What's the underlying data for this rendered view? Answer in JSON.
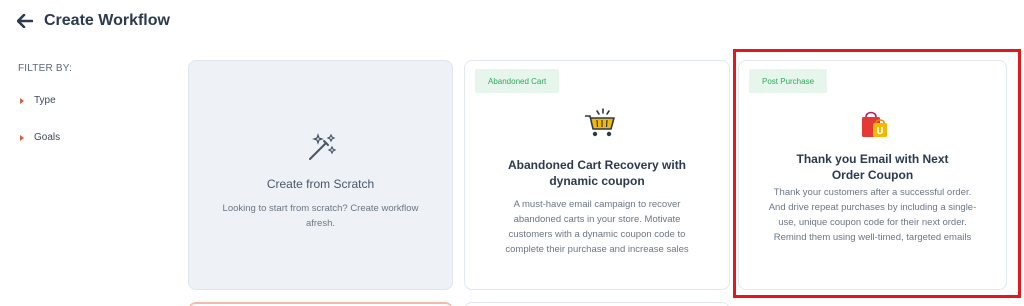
{
  "header": {
    "title": "Create Workflow"
  },
  "sidebar": {
    "filter_label": "FILTER BY:",
    "filters": [
      {
        "label": "Type"
      },
      {
        "label": "Goals"
      }
    ]
  },
  "cards": {
    "scratch": {
      "title": "Create from Scratch",
      "description": "Looking to start from scratch? Create workflow afresh.",
      "icon": "magic-wand-icon"
    },
    "abandoned": {
      "tag": "Abandoned Cart",
      "title": "Abandoned Cart Recovery with dynamic coupon",
      "description": "A must-have email campaign to recover abandoned carts in your store. Motivate customers with a dynamic coupon code to complete their purchase and increase sales",
      "icon": "shopping-cart-icon"
    },
    "post_purchase": {
      "tag": "Post Purchase",
      "title": "Thank you Email with Next Order Coupon",
      "description": "Thank your customers after a successful order. And drive repeat purchases by including a single-use, unique coupon code for their next order. Remind them using well-timed, targeted emails",
      "icon": "shopping-bags-icon"
    }
  },
  "colors": {
    "tag_bg": "#e6f6ec",
    "tag_text": "#2eaa5c",
    "highlight": "#e5161c",
    "accent_caret": "#e05a3a"
  }
}
